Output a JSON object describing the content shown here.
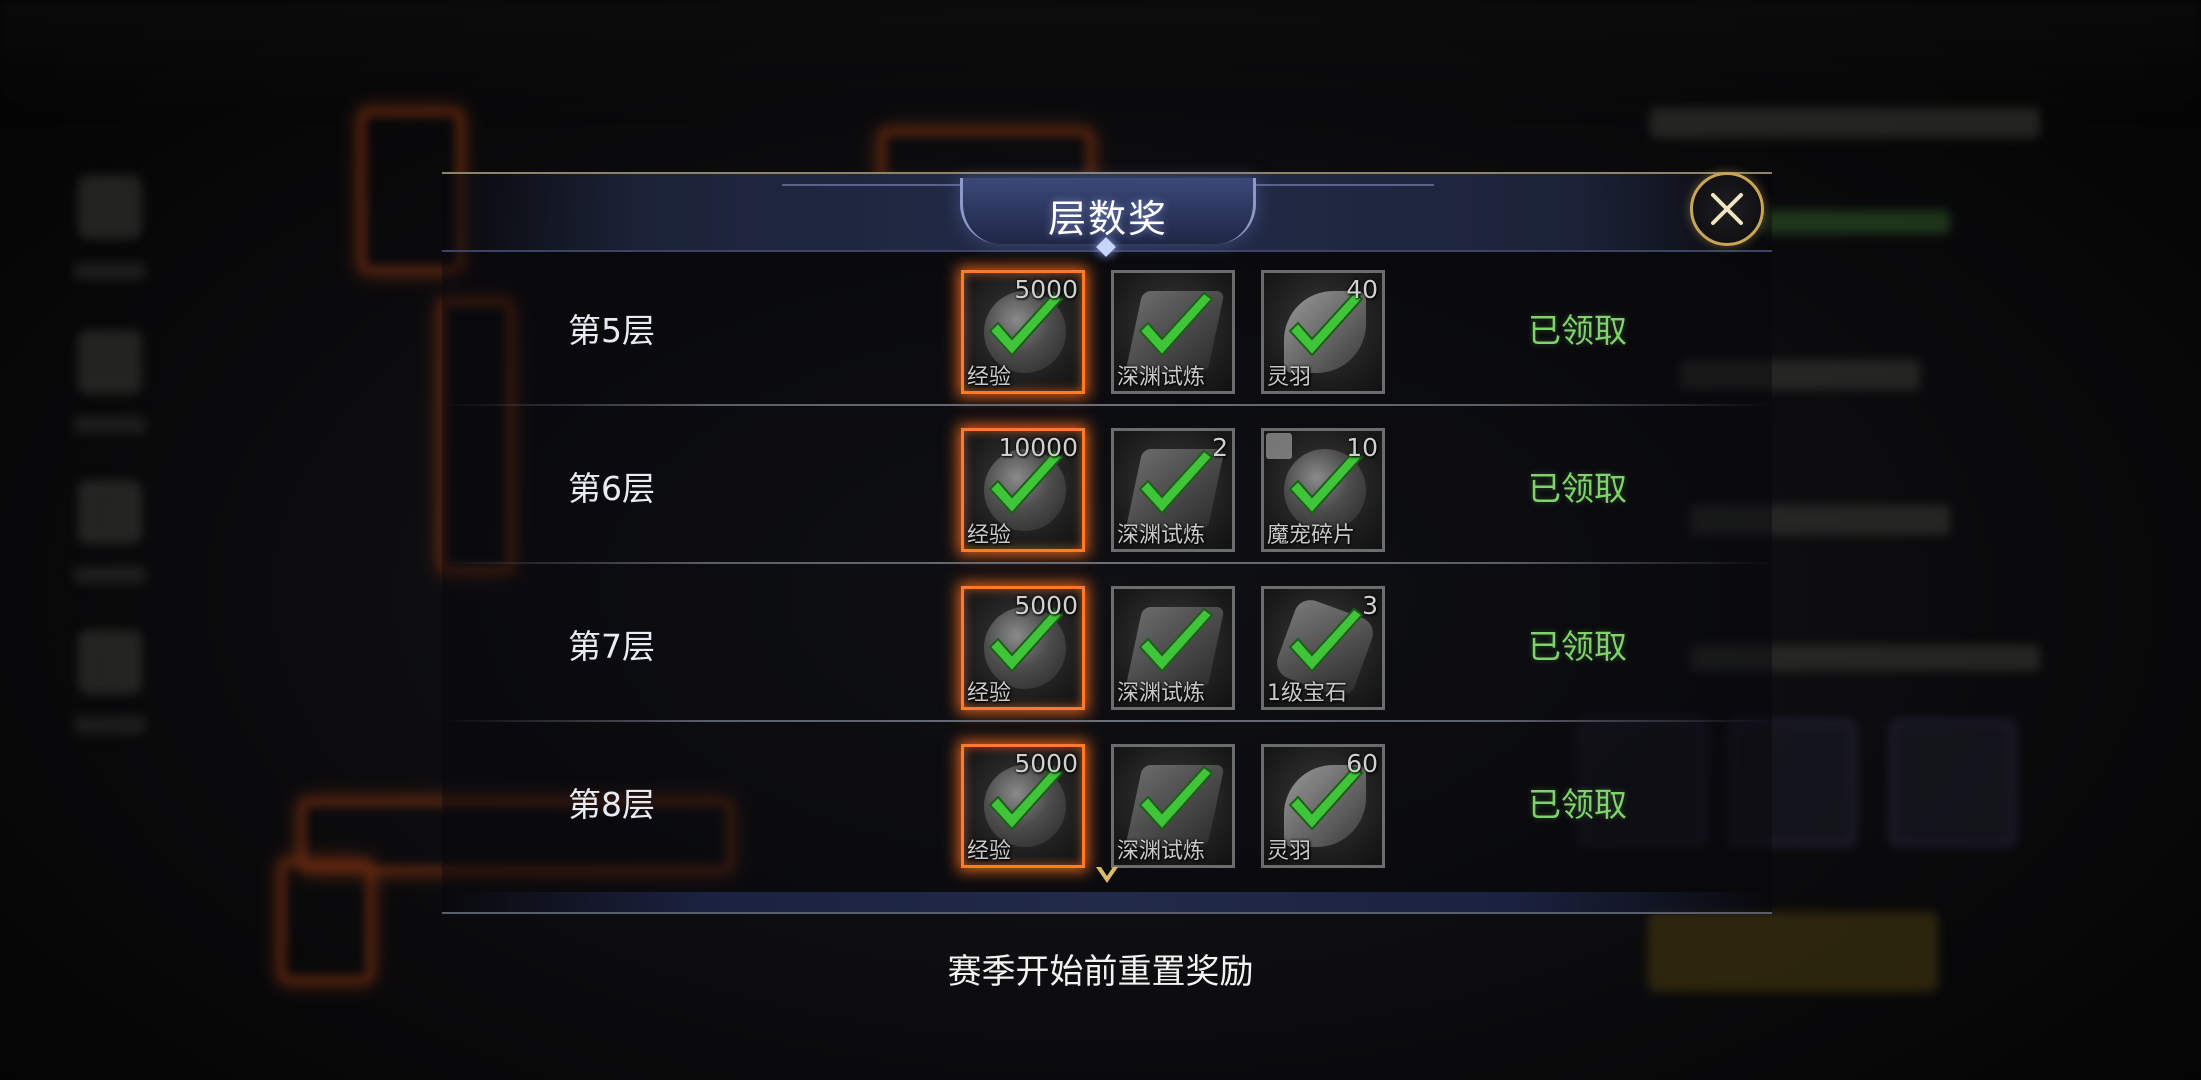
{
  "modal": {
    "title": "层数奖",
    "close_icon": "close-icon"
  },
  "rows": [
    {
      "floor_label": "第5层",
      "status": "已领取",
      "items": [
        {
          "name": "经验",
          "count": "5000",
          "glow": true,
          "art": "exp"
        },
        {
          "name": "深渊试炼",
          "count": "",
          "glow": false,
          "art": "scroll"
        },
        {
          "name": "灵羽",
          "count": "40",
          "glow": false,
          "art": "feather"
        }
      ]
    },
    {
      "floor_label": "第6层",
      "status": "已领取",
      "items": [
        {
          "name": "经验",
          "count": "10000",
          "glow": true,
          "art": "exp"
        },
        {
          "name": "深渊试炼",
          "count": "2",
          "glow": false,
          "art": "scroll"
        },
        {
          "name": "魔宠碎片",
          "count": "10",
          "glow": false,
          "art": "egg"
        }
      ]
    },
    {
      "floor_label": "第7层",
      "status": "已领取",
      "items": [
        {
          "name": "经验",
          "count": "5000",
          "glow": true,
          "art": "exp"
        },
        {
          "name": "深渊试炼",
          "count": "",
          "glow": false,
          "art": "scroll"
        },
        {
          "name": "1级宝石",
          "count": "3",
          "glow": false,
          "art": "gem"
        }
      ]
    },
    {
      "floor_label": "第8层",
      "status": "已领取",
      "items": [
        {
          "name": "经验",
          "count": "5000",
          "glow": true,
          "art": "exp"
        },
        {
          "name": "深渊试炼",
          "count": "",
          "glow": false,
          "art": "scroll"
        },
        {
          "name": "灵羽",
          "count": "60",
          "glow": false,
          "art": "feather"
        }
      ]
    }
  ],
  "footer": {
    "note": "赛季开始前重置奖励"
  },
  "colors": {
    "claimed_status": "#7fd36a",
    "glow_border": "#ff7a2a",
    "close_ring": "#c9a657",
    "check_green": "#3fc43a"
  }
}
